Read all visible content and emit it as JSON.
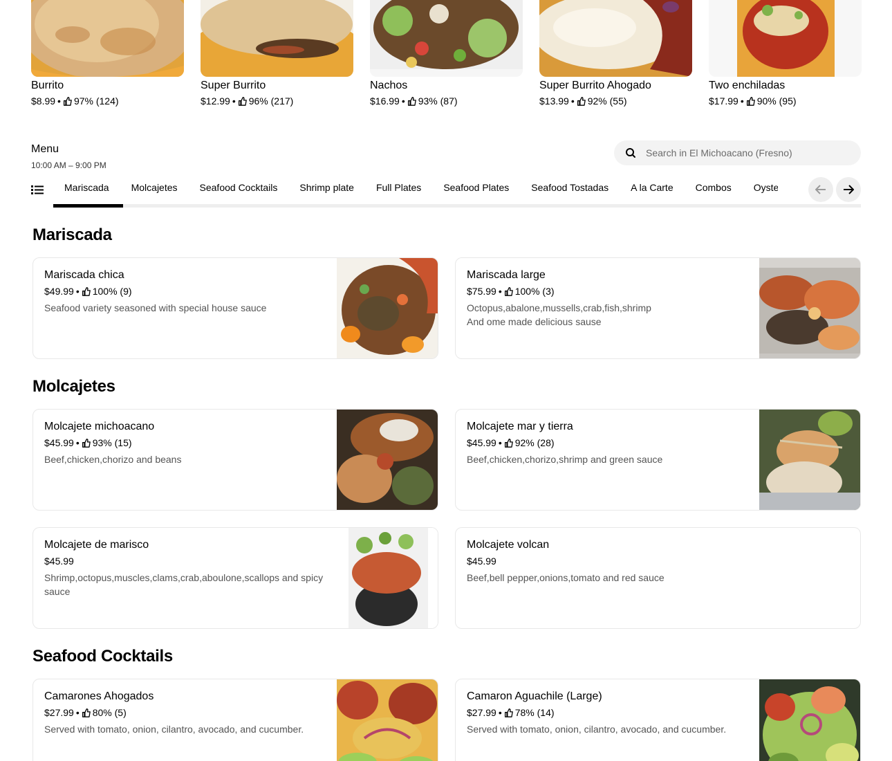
{
  "featured": [
    {
      "title": "Burrito",
      "price": "$8.99",
      "rating": "97% (124)"
    },
    {
      "title": "Super Burrito",
      "price": "$12.99",
      "rating": "96% (217)"
    },
    {
      "title": "Nachos",
      "price": "$16.99",
      "rating": "93% (87)"
    },
    {
      "title": "Super Burrito Ahogado",
      "price": "$13.99",
      "rating": "92% (55)"
    },
    {
      "title": "Two enchiladas",
      "price": "$17.99",
      "rating": "90% (95)"
    }
  ],
  "menu": {
    "title": "Menu",
    "hours": "10:00 AM – 9:00 PM"
  },
  "search": {
    "placeholder": "Search in El Michoacano (Fresno)"
  },
  "tabs": [
    "Mariscada",
    "Molcajetes",
    "Seafood Cocktails",
    "Shrimp plate",
    "Full Plates",
    "Seafood Plates",
    "Seafood Tostadas",
    "A la Carte",
    "Combos",
    "Oysters"
  ],
  "separator": "•",
  "sections": [
    {
      "title": "Mariscada",
      "items": [
        {
          "name": "Mariscada chica",
          "price": "$49.99",
          "rating": "100% (9)",
          "desc": "Seafood variety seasoned with special house sauce"
        },
        {
          "name": "Mariscada large",
          "price": "$75.99",
          "rating": "100% (3)",
          "desc": "Octopus,abalone,mussells,crab,fish,shrimp\nAnd ome made delicious sause"
        }
      ]
    },
    {
      "title": "Molcajetes",
      "items": [
        {
          "name": "Molcajete michoacano",
          "price": "$45.99",
          "rating": "93% (15)",
          "desc": "Beef,chicken,chorizo and beans"
        },
        {
          "name": "Molcajete mar y tierra",
          "price": "$45.99",
          "rating": "92% (28)",
          "desc": "Beef,chicken,chorizo,shrimp and green sauce"
        },
        {
          "name": "Molcajete de marisco",
          "price": "$45.99",
          "desc": "Shrimp,octopus,muscles,clams,crab,aboulone,scallops and spicy sauce"
        },
        {
          "name": "Molcajete volcan",
          "price": "$45.99",
          "desc": "Beef,bell pepper,onions,tomato and red sauce"
        }
      ]
    },
    {
      "title": "Seafood Cocktails",
      "items": [
        {
          "name": "Camarones Ahogados",
          "price": "$27.99",
          "rating": "80% (5)",
          "desc": "Served with tomato, onion, cilantro, avocado, and cucumber."
        },
        {
          "name": "Camaron Aguachile (Large)",
          "price": "$27.99",
          "rating": "78% (14)",
          "desc": "Served with tomato, onion, cilantro, avocado, and cucumber."
        }
      ]
    }
  ],
  "icons": {
    "thumb": "thumbs-up-icon",
    "search": "search-icon",
    "list": "list-icon",
    "prev": "arrow-left-icon",
    "next": "arrow-right-icon"
  },
  "colors": {
    "accent": "#000000",
    "muted_text": "#545454",
    "search_bg": "#f3f3f3"
  }
}
